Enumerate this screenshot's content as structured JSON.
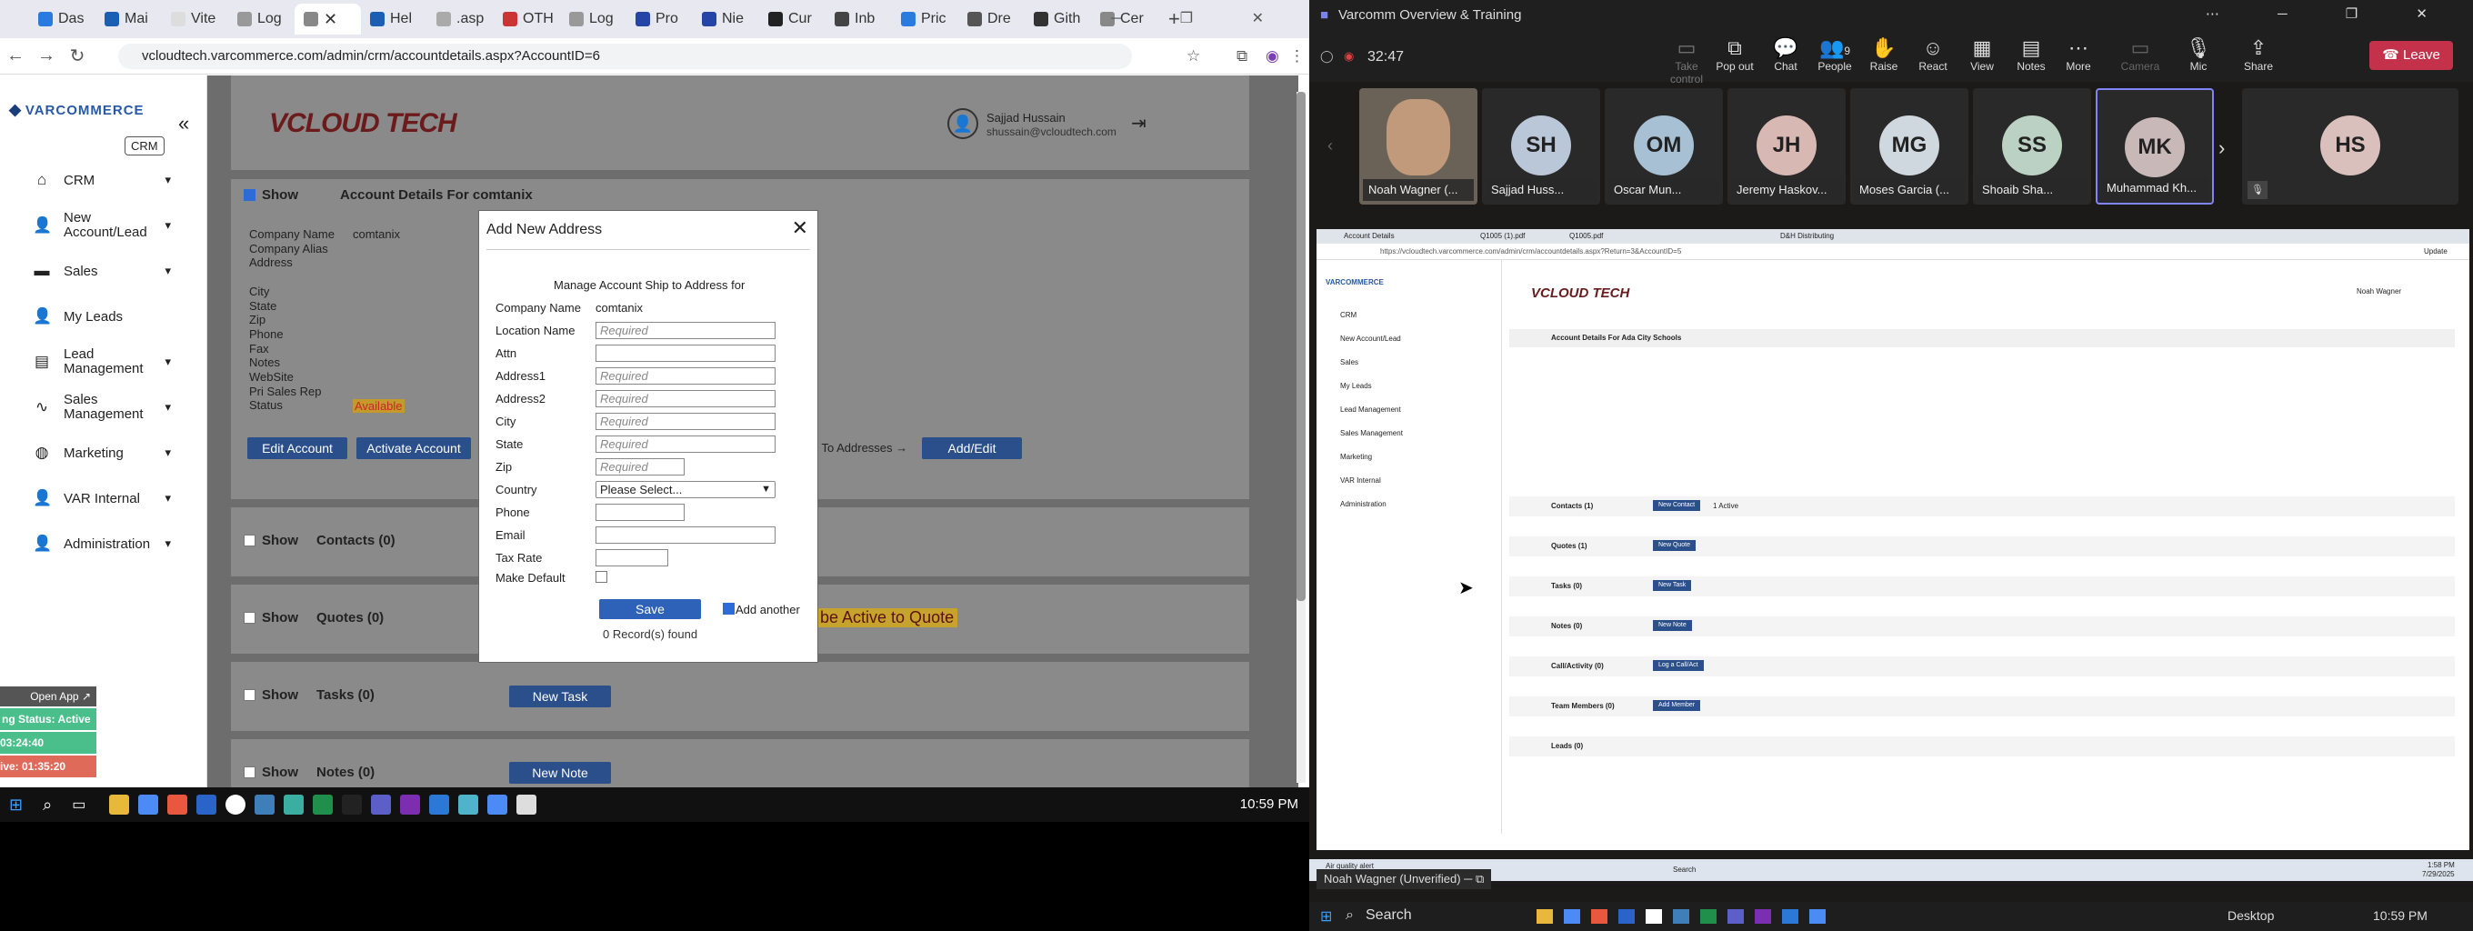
{
  "browser": {
    "tabs": [
      "Das",
      "Mai",
      "Vite",
      "Log",
      "",
      "Hel",
      ".asp",
      "OTH",
      "Log",
      "Pro",
      "Nie",
      "Cur",
      "Inb",
      "Pric",
      "Dre",
      "Gith",
      "Cer"
    ],
    "url": "vcloudtech.varcommerce.com/admin/crm/accountdetails.aspx?AccountID=6"
  },
  "sidebar": {
    "logo": "VARCOMMERCE",
    "badge": "CRM",
    "items": [
      {
        "label": "CRM",
        "icon": "home-icon"
      },
      {
        "label": "New Account/Lead",
        "icon": "user-plus-icon"
      },
      {
        "label": "Sales",
        "icon": "folder-icon"
      },
      {
        "label": "My Leads",
        "icon": "user-icon"
      },
      {
        "label": "Lead Management",
        "icon": "clipboard-icon"
      },
      {
        "label": "Sales Management",
        "icon": "chart-icon"
      },
      {
        "label": "Marketing",
        "icon": "globe-icon"
      },
      {
        "label": "VAR Internal",
        "icon": "user-icon"
      },
      {
        "label": "Administration",
        "icon": "user-icon"
      }
    ],
    "open_app": "Open App",
    "status": "ng Status: Active",
    "timer1": "03:24:40",
    "timer2": "ive: 01:35:20"
  },
  "header": {
    "brand": "VCLOUD TECH",
    "user_name": "Sajjad Hussain",
    "user_email": "shussain@vcloudtech.com"
  },
  "account": {
    "show": "Show",
    "title": "Account Details For comtanix",
    "labels": [
      "Company Name",
      "Company Alias",
      "Address",
      "",
      "City",
      "State",
      "Zip",
      "Phone",
      "Fax",
      "Notes",
      "WebSite",
      "Pri Sales Rep",
      "Status"
    ],
    "company": "comtanix",
    "status": "Available",
    "edit_btn": "Edit Account",
    "activate_btn": "Activate Account",
    "ship_to": "ip To Addresses →",
    "add_edit_btn": "Add/Edit"
  },
  "sections": [
    {
      "label": "Contacts (0)"
    },
    {
      "label": "Quotes (0)",
      "note": "t be Active to Quote"
    },
    {
      "label": "Tasks (0)",
      "button": "New Task"
    },
    {
      "label": "Notes (0)",
      "button": "New Note"
    }
  ],
  "modal": {
    "title": "Add New Address",
    "subtitle": "Manage Account Ship to Address for",
    "fields": [
      {
        "label": "Company Name",
        "value": "comtanix"
      },
      {
        "label": "Location Name",
        "placeholder": "Required"
      },
      {
        "label": "Attn",
        "placeholder": ""
      },
      {
        "label": "Address1",
        "placeholder": "Required"
      },
      {
        "label": "Address2",
        "placeholder": "Required"
      },
      {
        "label": "City",
        "placeholder": "Required"
      },
      {
        "label": "State",
        "placeholder": "Required"
      },
      {
        "label": "Zip",
        "placeholder": "Required"
      },
      {
        "label": "Country",
        "value": "Please Select..."
      },
      {
        "label": "Phone",
        "placeholder": ""
      },
      {
        "label": "Email",
        "placeholder": ""
      },
      {
        "label": "Tax Rate",
        "placeholder": ""
      },
      {
        "label": "Make Default",
        "placeholder": ""
      }
    ],
    "save": "Save",
    "add_another": "Add another",
    "records": "0 Record(s) found"
  },
  "left_clock": "10:59 PM",
  "teams": {
    "title": "Varcomm Overview & Training",
    "timer": "32:47",
    "controls": [
      "Take control",
      "Pop out",
      "Chat",
      "People",
      "Raise",
      "React",
      "View",
      "Notes",
      "More",
      "Camera",
      "Mic",
      "Share"
    ],
    "people_count": "9",
    "leave": "Leave",
    "participants": [
      {
        "initials": "",
        "name": "Noah Wagner (...",
        "color": "#6b6257"
      },
      {
        "initials": "SH",
        "name": "Sajjad Huss...",
        "color": "#b9c7d9"
      },
      {
        "initials": "OM",
        "name": "Oscar Mun...",
        "color": "#a8c0d4"
      },
      {
        "initials": "JH",
        "name": "Jeremy Haskov...",
        "color": "#d8b8b3"
      },
      {
        "initials": "MG",
        "name": "Moses Garcia (...",
        "color": "#cfd7df"
      },
      {
        "initials": "SS",
        "name": "Shoaib Sha...",
        "color": "#bad1c3"
      },
      {
        "initials": "MK",
        "name": "Muhammad Kh...",
        "color": "#c9b8b8"
      },
      {
        "initials": "HS",
        "name": "",
        "color": "#d9c0bd"
      }
    ],
    "shared": {
      "tabs": [
        "Account Details",
        "Q1005 (1).pdf",
        "Q1005.pdf",
        "D&H Distributing"
      ],
      "url": "https://vcloudtech.varcommerce.com/admin/crm/accountdetails.aspx?Return=3&AccountID=5",
      "update": "Update",
      "title": "Account Details For Ada City Schools",
      "user": "Noah Wagner",
      "sections": [
        "Contacts (1)",
        "Quotes (1)",
        "Tasks (0)",
        "Notes (0)",
        "Call/Activity (0)",
        "Team Members (0)",
        "Leads (0)"
      ],
      "section_buttons": [
        "New Contact",
        "New Quote",
        "New Task",
        "New Note",
        "Log a Call/Act",
        "Add Member",
        ""
      ],
      "active_label": "1 Active",
      "air_alert": "Air quality alert",
      "search": "Search",
      "clock": "1:58 PM",
      "date": "7/29/2025"
    },
    "unverified": "Noah Wagner (Unverified)",
    "task_search": "Search",
    "desktop": "Desktop",
    "clock": "10:59 PM"
  }
}
